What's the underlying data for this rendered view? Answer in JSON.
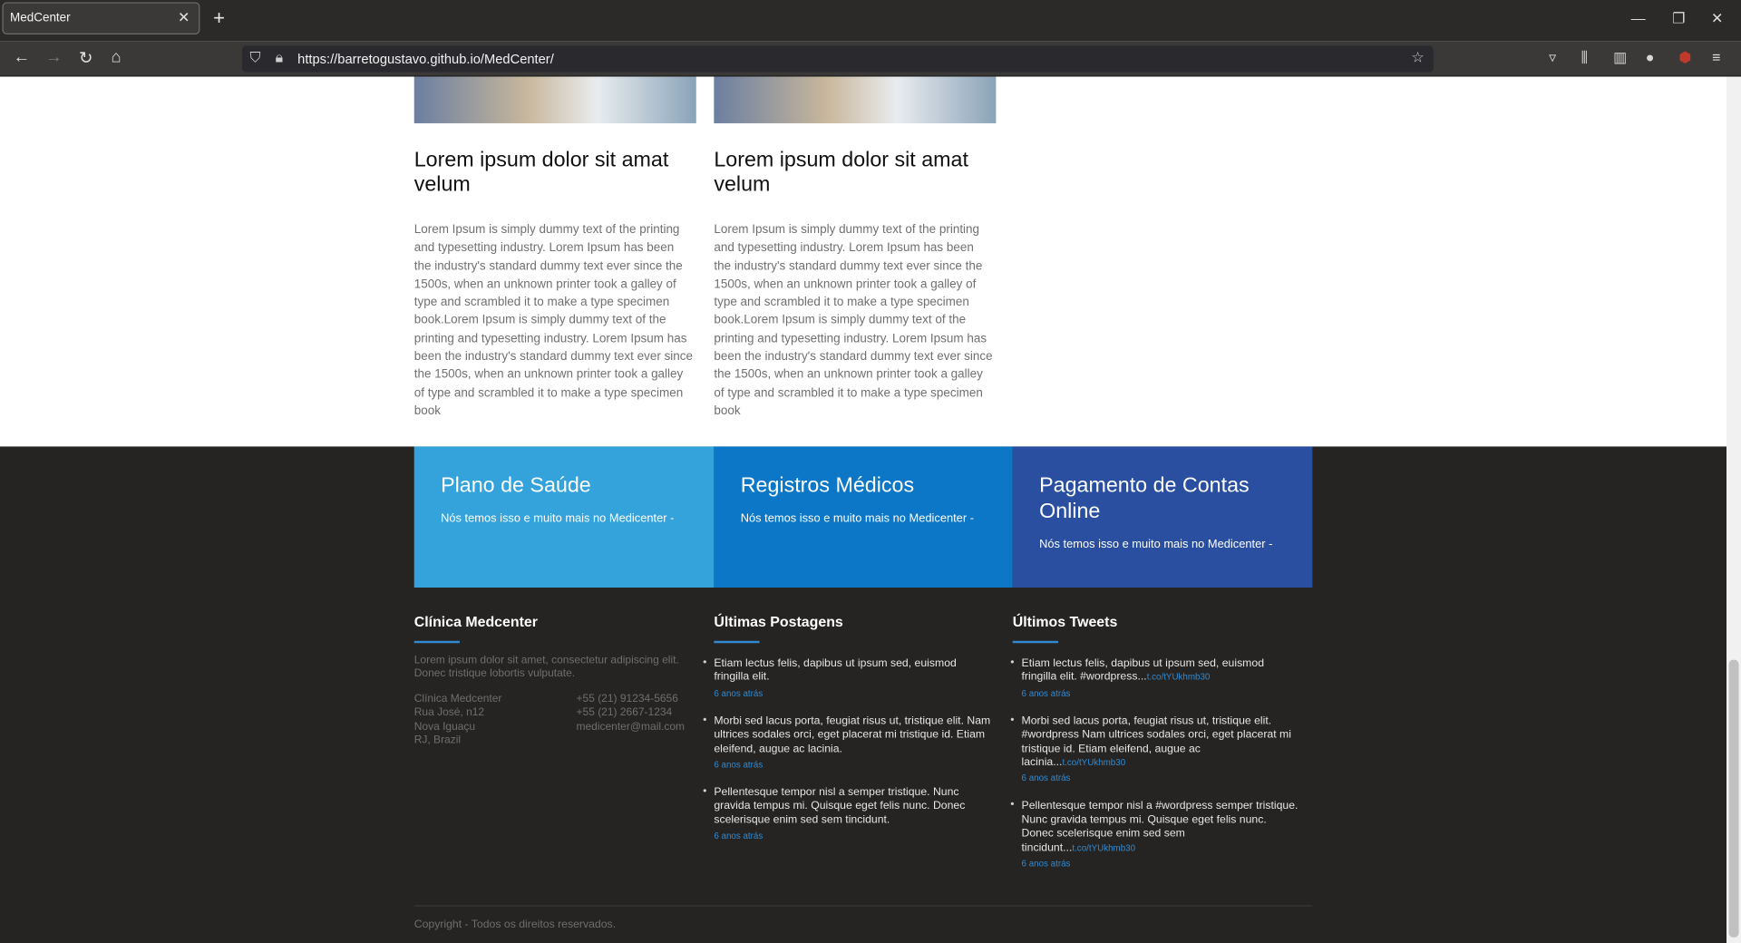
{
  "browser": {
    "tab_title": "MedCenter",
    "tab_close": "✕",
    "new_tab": "+",
    "url": "https://barretogustavo.github.io/MedCenter/"
  },
  "cards": [
    {
      "title": "Lorem ipsum dolor sit amat velum",
      "body": "Lorem Ipsum is simply dummy text of the printing and typesetting industry. Lorem Ipsum has been the industry's standard dummy text ever since the 1500s, when an unknown printer took a galley of type and scrambled it to make a type specimen book.Lorem Ipsum is simply dummy text of the printing and typesetting industry. Lorem Ipsum has been the industry's standard dummy text ever since the 1500s, when an unknown printer took a galley of type and scrambled it to make a type specimen book"
    },
    {
      "title": "Lorem ipsum dolor sit amat velum",
      "body": "Lorem Ipsum is simply dummy text of the printing and typesetting industry. Lorem Ipsum has been the industry's standard dummy text ever since the 1500s, when an unknown printer took a galley of type and scrambled it to make a type specimen book.Lorem Ipsum is simply dummy text of the printing and typesetting industry. Lorem Ipsum has been the industry's standard dummy text ever since the 1500s, when an unknown printer took a galley of type and scrambled it to make a type specimen book"
    }
  ],
  "features": [
    {
      "title": "Plano de Saúde",
      "text": "Nós temos isso e muito mais no Medicenter -",
      "color": "#34a3dc"
    },
    {
      "title": "Registros Médicos",
      "text": "Nós temos isso e muito mais no Medicenter -",
      "color": "#0b77c6"
    },
    {
      "title": "Pagamento de Contas Online",
      "text": "Nós temos isso e muito mais no Medicenter -",
      "color": "#2a4fa0"
    }
  ],
  "footer": {
    "clinic": {
      "title": "Clínica Medcenter",
      "description": "Lorem ipsum dolor sit amet, consectetur adipiscing elit. Donec tristique lobortis vulputate.",
      "address": [
        "Clínica Medcenter",
        "Rua José, n12",
        "Nova Iguaçu",
        "RJ, Brazil"
      ],
      "contact": [
        "+55 (21) 91234-5656",
        "+55 (21) 2667-1234",
        "medicenter@mail.com"
      ]
    },
    "posts": {
      "title": "Últimas Postagens",
      "items": [
        {
          "text": "Etiam lectus felis, dapibus ut ipsum sed, euismod fringilla elit.",
          "time": "6 anos atrás"
        },
        {
          "text": "Morbi sed lacus porta, feugiat risus ut, tristique elit. Nam ultrices sodales orci, eget placerat mi tristique id. Etiam eleifend, augue ac lacinia.",
          "time": "6 anos atrás"
        },
        {
          "text": "Pellentesque tempor nisl a semper tristique. Nunc gravida tempus mi. Quisque eget felis nunc. Donec scelerisque enim sed sem tincidunt.",
          "time": "6 anos atrás"
        }
      ]
    },
    "tweets": {
      "title": "Últimos Tweets",
      "items": [
        {
          "text": "Etiam lectus felis, dapibus ut ipsum sed, euismod fringilla elit. #wordpress...",
          "link": "t.co/tYUkhmb30",
          "time": "6 anos atrás"
        },
        {
          "text": "Morbi sed lacus porta, feugiat risus ut, tristique elit. #wordpress Nam ultrices sodales orci, eget placerat mi tristique id. Etiam eleifend, augue ac lacinia...",
          "link": "t.co/tYUkhmb30",
          "time": "6 anos atrás"
        },
        {
          "text": "Pellentesque tempor nisl a #wordpress semper tristique. Nunc gravida tempus mi. Quisque eget felis nunc. Donec scelerisque enim sed sem tincidunt...",
          "link": "t.co/tYUkhmb30",
          "time": "6 anos atrás"
        }
      ]
    },
    "copyright": "Copyright - Todos os direitos reservados."
  }
}
